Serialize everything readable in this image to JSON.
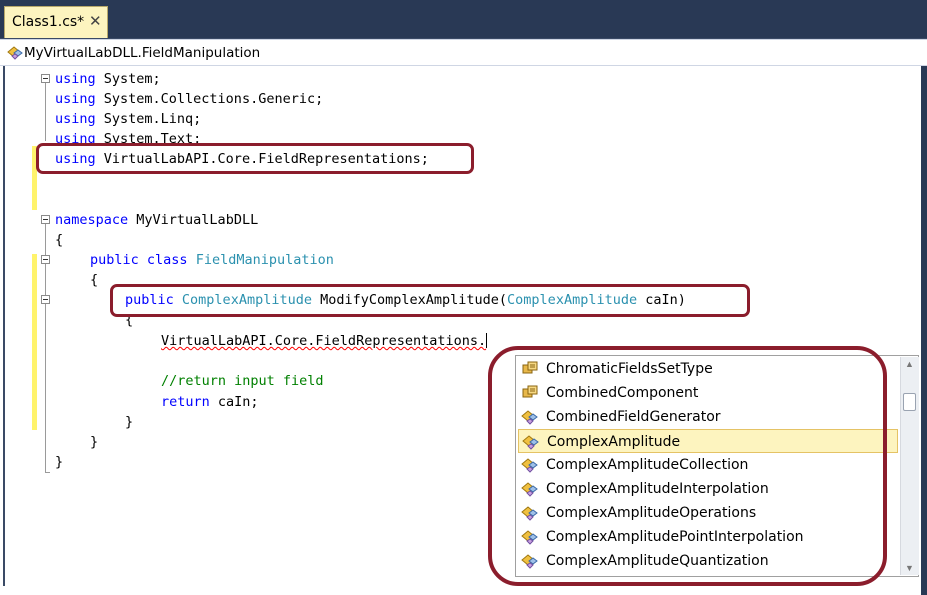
{
  "tab": {
    "label": "Class1.cs*",
    "close": "✕"
  },
  "navbar": {
    "label": "MyVirtualLabDLL.FieldManipulation"
  },
  "code": {
    "l1": [
      "using",
      " System;"
    ],
    "l2": [
      "using",
      " System.Collections.Generic;"
    ],
    "l3": [
      "using",
      " System.Linq;"
    ],
    "l4": [
      "using",
      " System.Text;"
    ],
    "l5": [
      "using",
      " VirtualLabAPI.Core.FieldRepresentations;"
    ],
    "l7": [
      "namespace",
      " MyVirtualLabDLL"
    ],
    "l8": "{",
    "l9": [
      "public",
      "class",
      "FieldManipulation"
    ],
    "l10": "{",
    "l11": [
      "public",
      "ComplexAmplitude",
      " ModifyComplexAmplitude(",
      "ComplexAmplitude",
      " caIn)"
    ],
    "l12": "{",
    "l13": "VirtualLabAPI.Core.FieldRepresentations.",
    "l15": "//return input field",
    "l16": [
      "return",
      " caIn;"
    ],
    "l17": "}",
    "l18": "}",
    "l19": "}"
  },
  "intellisense": {
    "items": [
      {
        "label": "ChromaticFieldsSetType",
        "icon": "enum-icon"
      },
      {
        "label": "CombinedComponent",
        "icon": "enum-icon"
      },
      {
        "label": "CombinedFieldGenerator",
        "icon": "class-icon"
      },
      {
        "label": "ComplexAmplitude",
        "icon": "class-icon",
        "selected": true
      },
      {
        "label": "ComplexAmplitudeCollection",
        "icon": "class-icon"
      },
      {
        "label": "ComplexAmplitudeInterpolation",
        "icon": "class-icon"
      },
      {
        "label": "ComplexAmplitudeOperations",
        "icon": "class-icon"
      },
      {
        "label": "ComplexAmplitudePointInterpolation",
        "icon": "class-icon"
      },
      {
        "label": "ComplexAmplitudeQuantization",
        "icon": "class-icon"
      }
    ]
  },
  "colors": {
    "keyword": "#0000ff",
    "type": "#2b91af",
    "comment": "#008000",
    "highlight": "#8b1d2c",
    "selection": "#fdf4bf"
  }
}
